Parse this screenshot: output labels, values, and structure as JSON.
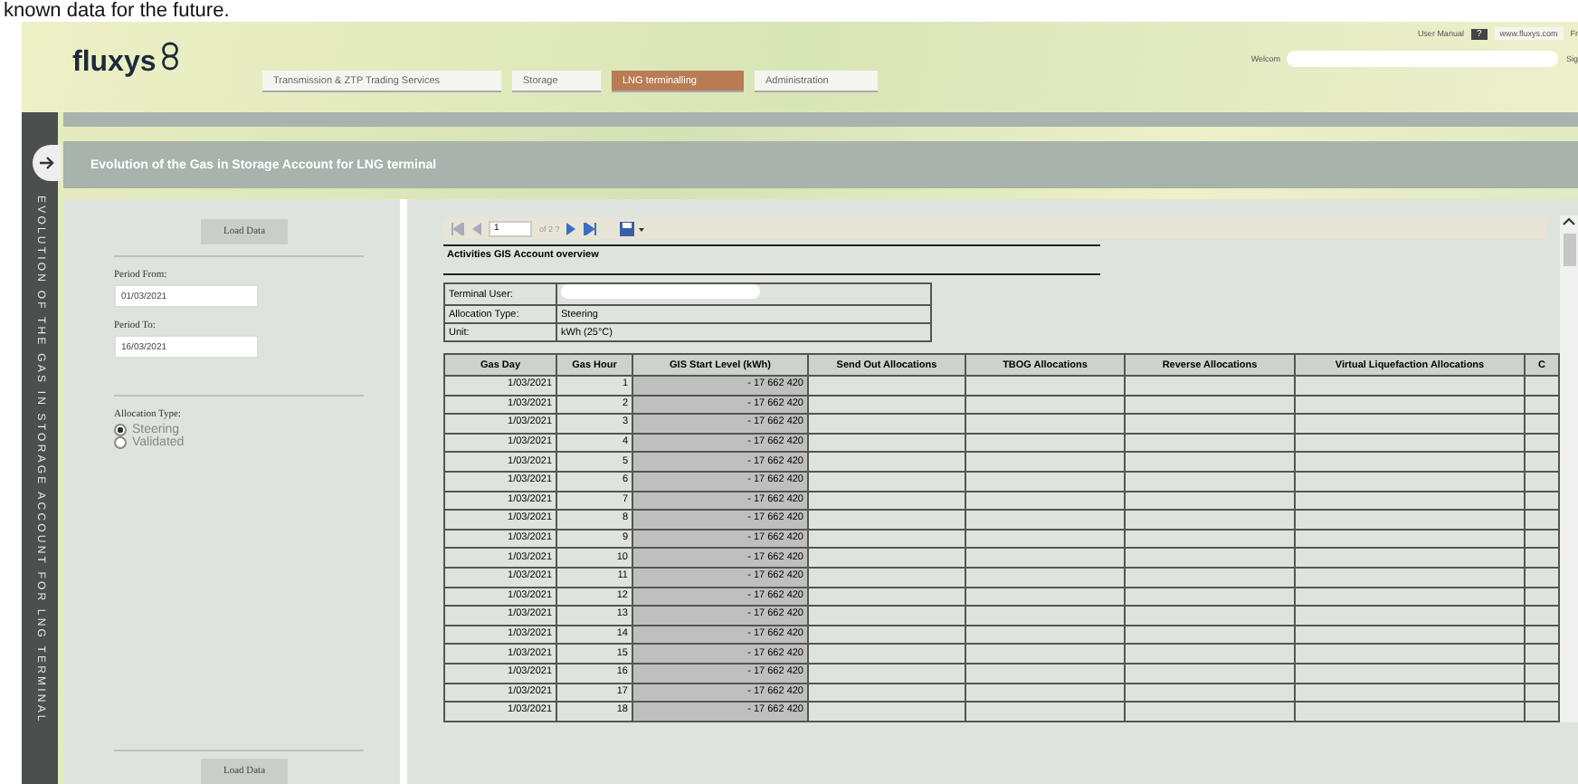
{
  "caption": "known data for the future.",
  "header": {
    "logo": "fluxys",
    "tabs": [
      {
        "label": "Transmission & ZTP Trading Services",
        "selected": false
      },
      {
        "label": "Storage",
        "selected": false
      },
      {
        "label": "LNG terminalling",
        "selected": true
      },
      {
        "label": "Administration",
        "selected": false
      }
    ],
    "user_manual": "User Manual",
    "help": "?",
    "site": "www.fluxys.com",
    "language": "Fr",
    "welcome": "Welcom",
    "sign": "Sig"
  },
  "sidebar": {
    "label": "EVOLUTION OF THE GAS IN STORAGE ACCOUNT FOR LNG TERMINAL"
  },
  "page_title": "Evolution of the Gas in Storage Account for LNG terminal",
  "filters": {
    "load_button": "Load Data",
    "period_from": {
      "label": "Period From:",
      "value": "01/03/2021"
    },
    "period_to": {
      "label": "Period To:",
      "value": "16/03/2021"
    },
    "allocation_type": {
      "label": "Allocation Type:",
      "options": [
        {
          "label": "Steering",
          "selected": true
        },
        {
          "label": "Validated",
          "selected": false
        }
      ]
    },
    "bottom_button": "Load Data"
  },
  "report": {
    "pager": {
      "page": "1",
      "of": "of 2 ?"
    },
    "title": "Activities GIS Account overview",
    "info": [
      {
        "label": "Terminal User:",
        "redacted": true
      },
      {
        "label": "Allocation Type:",
        "value": "Steering",
        "redacted": false
      },
      {
        "label": "Unit:",
        "value": "kWh (25°C)",
        "redacted": false
      }
    ],
    "columns": [
      "Gas Day",
      "Gas Hour",
      "GIS Start Level (kWh)",
      "Send Out Allocations",
      "TBOG Allocations",
      "Reverse Allocations",
      "Virtual Liquefaction Allocations",
      "C"
    ],
    "rows": [
      [
        "1/03/2021",
        "1",
        "- 17 662 420"
      ],
      [
        "1/03/2021",
        "2",
        "- 17 662 420"
      ],
      [
        "1/03/2021",
        "3",
        "- 17 662 420"
      ],
      [
        "1/03/2021",
        "4",
        "- 17 662 420"
      ],
      [
        "1/03/2021",
        "5",
        "- 17 662 420"
      ],
      [
        "1/03/2021",
        "6",
        "- 17 662 420"
      ],
      [
        "1/03/2021",
        "7",
        "- 17 662 420"
      ],
      [
        "1/03/2021",
        "8",
        "- 17 662 420"
      ],
      [
        "1/03/2021",
        "9",
        "- 17 662 420"
      ],
      [
        "1/03/2021",
        "10",
        "- 17 662 420"
      ],
      [
        "1/03/2021",
        "11",
        "- 17 662 420"
      ],
      [
        "1/03/2021",
        "12",
        "- 17 662 420"
      ],
      [
        "1/03/2021",
        "13",
        "- 17 662 420"
      ],
      [
        "1/03/2021",
        "14",
        "- 17 662 420"
      ],
      [
        "1/03/2021",
        "15",
        "- 17 662 420"
      ],
      [
        "1/03/2021",
        "16",
        "- 17 662 420"
      ],
      [
        "1/03/2021",
        "17",
        "- 17 662 420"
      ],
      [
        "1/03/2021",
        "18",
        "- 17 662 420"
      ]
    ]
  }
}
